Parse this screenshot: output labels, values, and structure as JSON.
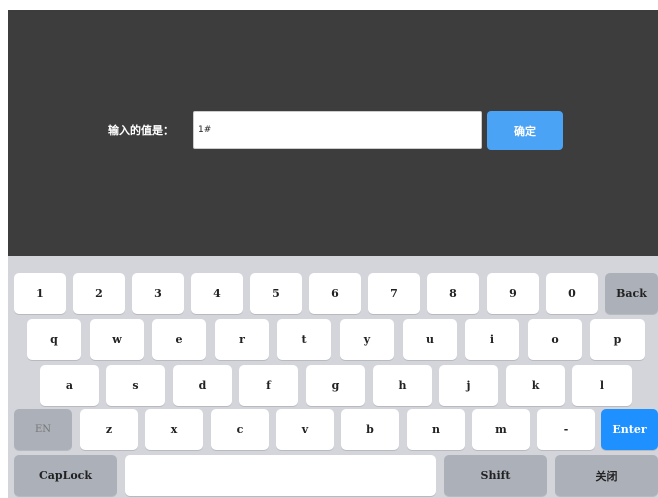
{
  "dialog": {
    "label": "输入的值是：",
    "input_value": "1#",
    "confirm_label": "确定"
  },
  "keyboard": {
    "row1": [
      "1",
      "2",
      "3",
      "4",
      "5",
      "6",
      "7",
      "8",
      "9",
      "0"
    ],
    "back": "Back",
    "row2": [
      "q",
      "w",
      "e",
      "r",
      "t",
      "y",
      "u",
      "i",
      "o",
      "p"
    ],
    "row3": [
      "a",
      "s",
      "d",
      "f",
      "g",
      "h",
      "j",
      "k",
      "l"
    ],
    "en": "EN",
    "row4": [
      "z",
      "x",
      "c",
      "v",
      "b",
      "n",
      "m",
      "-"
    ],
    "enter": "Enter",
    "caplock": "CapLock",
    "space": "",
    "shift": "Shift",
    "close": "关闭"
  },
  "colors": {
    "panel_bg": "#3d3d3d",
    "keyboard_bg": "#d3d5db",
    "confirm": "#4aa3f5",
    "enter": "#1e90ff"
  }
}
